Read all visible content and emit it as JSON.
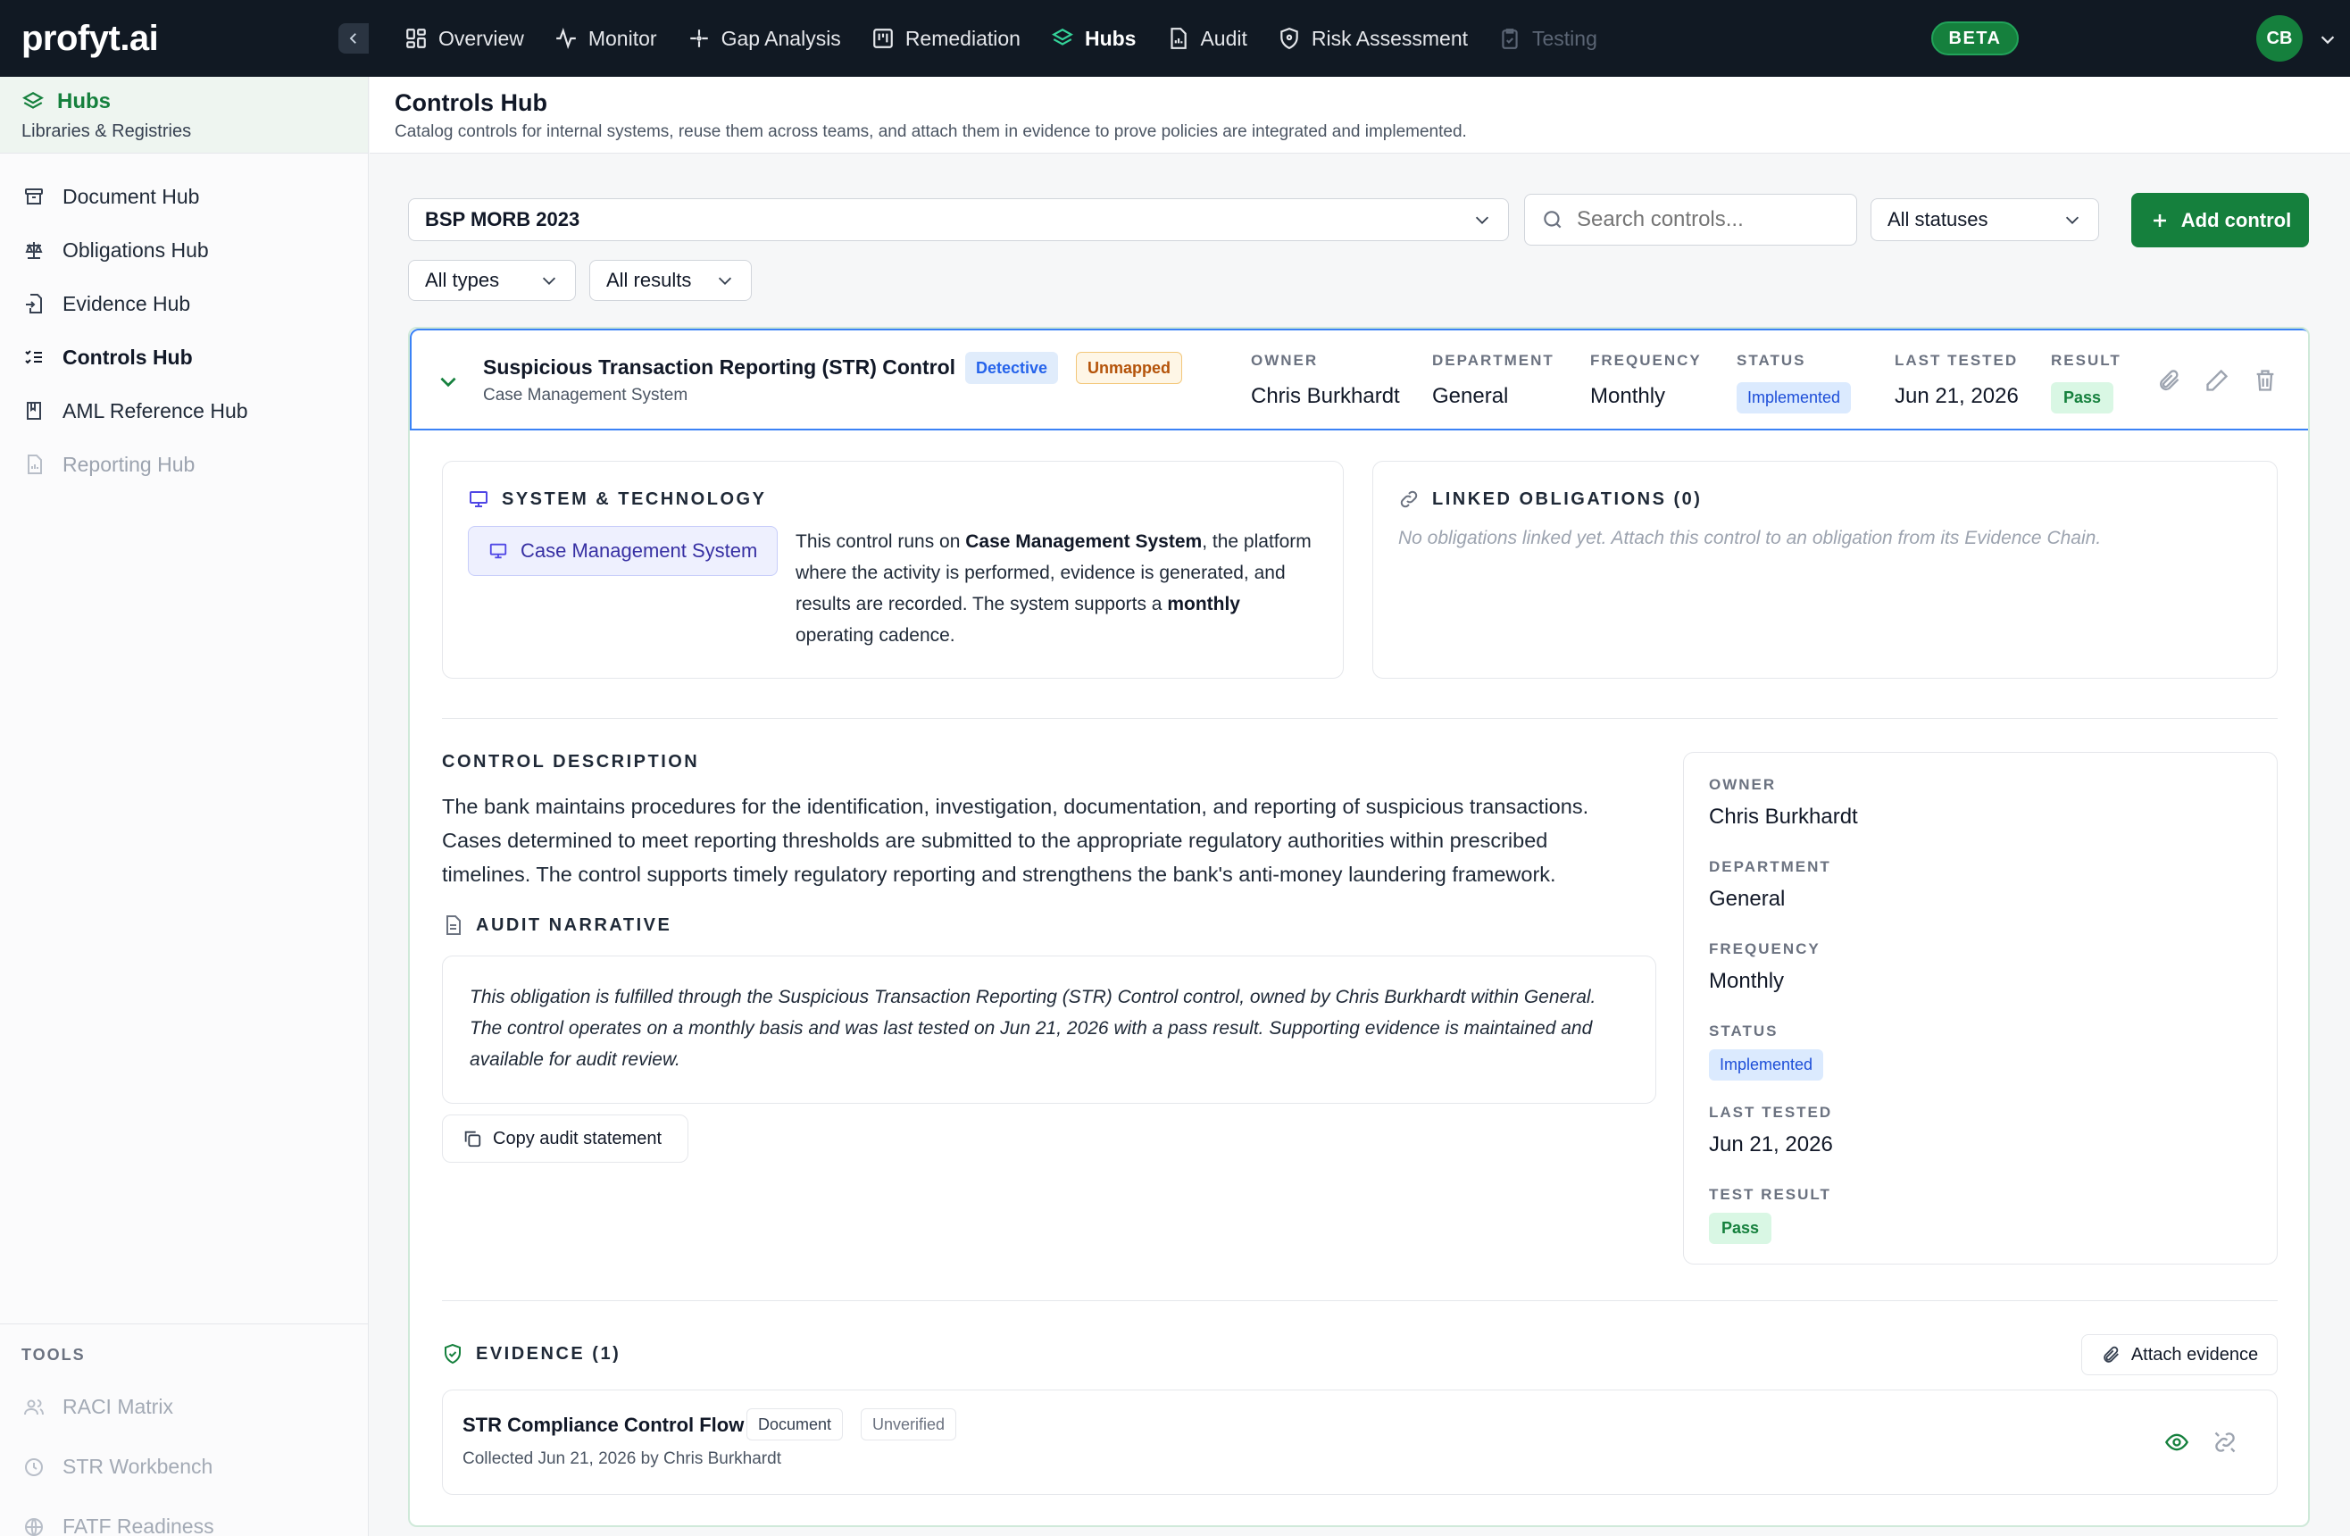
{
  "app": {
    "logo": "profyt.ai",
    "beta": "BETA",
    "user_initials": "CB"
  },
  "nav": [
    {
      "label": "Overview",
      "icon": "grid-icon",
      "state": "normal"
    },
    {
      "label": "Monitor",
      "icon": "activity-icon",
      "state": "normal"
    },
    {
      "label": "Gap Analysis",
      "icon": "sparkle-icon",
      "state": "normal"
    },
    {
      "label": "Remediation",
      "icon": "kanban-icon",
      "state": "normal"
    },
    {
      "label": "Hubs",
      "icon": "layers-icon",
      "state": "active"
    },
    {
      "label": "Audit",
      "icon": "file-chart-icon",
      "state": "normal"
    },
    {
      "label": "Risk Assessment",
      "icon": "shield-icon",
      "state": "normal"
    },
    {
      "label": "Testing",
      "icon": "clipboard-icon",
      "state": "disabled"
    }
  ],
  "sidebar": {
    "title": "Hubs",
    "subtitle": "Libraries & Registries",
    "items": [
      {
        "label": "Document Hub"
      },
      {
        "label": "Obligations Hub"
      },
      {
        "label": "Evidence Hub"
      },
      {
        "label": "Controls Hub"
      },
      {
        "label": "AML Reference Hub"
      },
      {
        "label": "Reporting Hub"
      }
    ],
    "tools_label": "TOOLS",
    "tools": [
      {
        "label": "RACI Matrix"
      },
      {
        "label": "STR Workbench"
      },
      {
        "label": "FATF Readiness"
      }
    ]
  },
  "page": {
    "title": "Controls Hub",
    "subtitle": "Catalog controls for internal systems, reuse them across teams, and attach them in evidence to prove policies are integrated and implemented."
  },
  "filters": {
    "framework": "BSP MORB 2023",
    "search_placeholder": "Search controls...",
    "status": "All statuses",
    "add_label": "Add control",
    "types": "All types",
    "results": "All results"
  },
  "control": {
    "title": "Suspicious Transaction Reporting (STR) Control",
    "system": "Case Management System",
    "type_badge": "Detective",
    "mapping_badge": "Unmapped",
    "owner_label": "OWNER",
    "owner": "Chris Burkhardt",
    "department_label": "DEPARTMENT",
    "department": "General",
    "frequency_label": "FREQUENCY",
    "frequency": "Monthly",
    "status_label": "STATUS",
    "status": "Implemented",
    "last_tested_label": "LAST TESTED",
    "last_tested": "Jun 21, 2026",
    "result_label": "RESULT",
    "result": "Pass"
  },
  "system_section": {
    "label": "SYSTEM & TECHNOLOGY",
    "chip": "Case Management System",
    "text_1": "This control runs on ",
    "text_bold_1": "Case Management System",
    "text_2": ", the platform where the activity is performed, evidence is generated, and results are recorded. The system supports a ",
    "text_bold_2": "monthly",
    "text_3": " operating cadence."
  },
  "linked": {
    "label": "LINKED OBLIGATIONS (0)",
    "empty": "No obligations linked yet. Attach this control to an obligation from its Evidence Chain."
  },
  "description": {
    "label": "CONTROL DESCRIPTION",
    "text": "The bank maintains procedures for the identification, investigation, documentation, and reporting of suspicious transactions. Cases determined to meet reporting thresholds are submitted to the appropriate regulatory authorities within prescribed timelines. The control supports timely regulatory reporting and strengthens the bank's anti-money laundering framework."
  },
  "narrative": {
    "label": "AUDIT NARRATIVE",
    "text": "This obligation is fulfilled through the Suspicious Transaction Reporting (STR) Control control, owned by Chris Burkhardt within General. The control operates on a monthly basis and was last tested on Jun 21, 2026 with a pass result. Supporting evidence is maintained and available for audit review.",
    "copy_label": "Copy audit statement"
  },
  "details": {
    "owner_label": "OWNER",
    "owner": "Chris Burkhardt",
    "department_label": "DEPARTMENT",
    "department": "General",
    "frequency_label": "FREQUENCY",
    "frequency": "Monthly",
    "status_label": "STATUS",
    "status": "Implemented",
    "last_tested_label": "LAST TESTED",
    "last_tested": "Jun 21, 2026",
    "result_label": "TEST RESULT",
    "result": "Pass"
  },
  "evidence": {
    "label": "EVIDENCE (1)",
    "attach_label": "Attach evidence",
    "items": [
      {
        "title": "STR Compliance Control Flow",
        "type": "Document",
        "verification": "Unverified",
        "collected": "Collected Jun 21, 2026 by Chris Burkhardt"
      }
    ]
  },
  "colors": {
    "accent": "#15803d",
    "topbar": "#111923",
    "selection": "#3b82f6"
  }
}
